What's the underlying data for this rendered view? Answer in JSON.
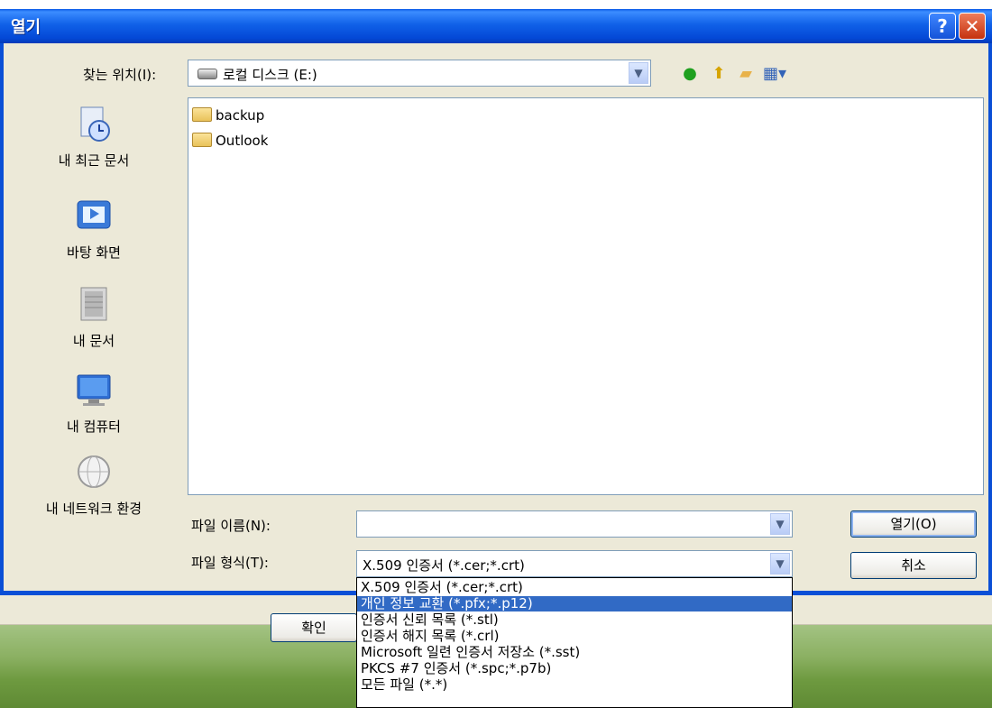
{
  "title": "열기",
  "title_buttons": {
    "help": "?",
    "close": "✕"
  },
  "location": {
    "label": "찾는 위치(I):",
    "value": "로컬 디스크 (E:)"
  },
  "places": [
    {
      "label": "내 최근 문서",
      "icon": "recent-documents-icon"
    },
    {
      "label": "바탕 화면",
      "icon": "desktop-icon"
    },
    {
      "label": "내 문서",
      "icon": "my-documents-icon"
    },
    {
      "label": "내 컴퓨터",
      "icon": "my-computer-icon"
    },
    {
      "label": "내 네트워크 환경",
      "icon": "network-icon"
    }
  ],
  "files": [
    {
      "name": "backup",
      "type": "folder"
    },
    {
      "name": "Outlook",
      "type": "folder"
    }
  ],
  "filename": {
    "label": "파일 이름(N):",
    "value": ""
  },
  "filetype": {
    "label": "파일 형식(T):",
    "value": "X.509 인증서 (*.cer;*.crt)"
  },
  "buttons": {
    "open": "열기(O)",
    "cancel": "취소"
  },
  "background": {
    "ok_button": "확인"
  },
  "filetype_options": [
    "X.509 인증서 (*.cer;*.crt)",
    "개인 정보 교환 (*.pfx;*.p12)",
    "인증서 신뢰 목록 (*.stl)",
    "인증서 해지 목록 (*.crl)",
    "Microsoft 일련 인증서 저장소 (*.sst)",
    "PKCS #7 인증서 (*.spc;*.p7b)",
    "모든 파일 (*.*)"
  ],
  "selected_option_index": 1,
  "colors": {
    "titlebar": "#0a5ae6",
    "selection": "#316ac5",
    "dialog_bg": "#ece9d8"
  }
}
